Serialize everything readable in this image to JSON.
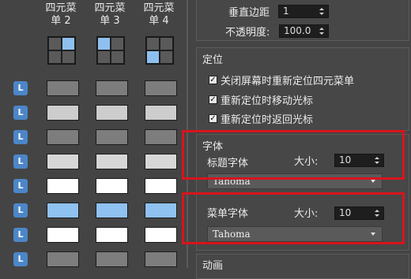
{
  "columns": [
    {
      "line1": "四元菜",
      "line2": "单 2",
      "quad_highlight": "top-right"
    },
    {
      "line1": "四元菜",
      "line2": "单 3",
      "quad_highlight": "top-left"
    },
    {
      "line1": "四元菜",
      "line2": "单 4",
      "quad_highlight": "bottom-left"
    }
  ],
  "l_button_label": "L",
  "swatch_rows": [
    [
      "#7d7d7d",
      "#7d7d7d",
      "#7d7d7d"
    ],
    [
      "#cdcdcd",
      "#cdcdcd",
      "#cdcdcd"
    ],
    [
      "#7d7d7d",
      "#7d7d7d",
      "#7d7d7d"
    ],
    [
      "#d7d7d7",
      "#d7d7d7",
      "#d7d7d7"
    ],
    [
      "#ffffff",
      "#ffffff",
      "#ffffff"
    ],
    [
      "#8fc2f0",
      "#8fc2f0",
      "#8fc2f0"
    ],
    [
      "#ffffff",
      "#ffffff",
      "#ffffff"
    ],
    [
      "#7d7d7d",
      "#7d7d7d",
      "#7d7d7d"
    ]
  ],
  "vertical_margin": {
    "label": "垂直边距",
    "value": "1"
  },
  "opacity": {
    "label": "不透明度:",
    "value": "100.0"
  },
  "positioning": {
    "title": "定位",
    "options": [
      {
        "label": "关闭屏幕时重新定位四元菜单",
        "checked": true
      },
      {
        "label": "重新定位时移动光标",
        "checked": true
      },
      {
        "label": "重新定位时返回光标",
        "checked": true
      }
    ]
  },
  "fonts": {
    "title": "字体",
    "title_font": {
      "label": "标题字体",
      "size_label": "大小:",
      "size": "10",
      "font": "Tahoma"
    },
    "menu_font": {
      "label": "菜单字体",
      "size_label": "大小:",
      "size": "10",
      "font": "Tahoma"
    }
  },
  "animation": {
    "title": "动画"
  },
  "colors": {
    "accent": "#4c86c8",
    "highlight": "#8ec0ef",
    "red_box": "#d8141c",
    "background": "#444444"
  }
}
